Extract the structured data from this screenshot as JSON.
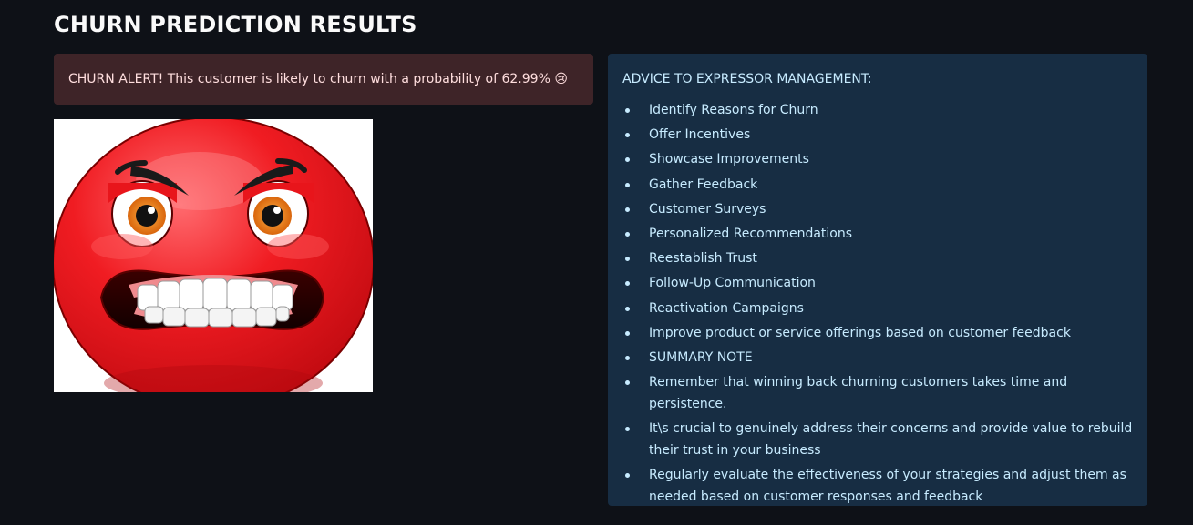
{
  "header": {
    "title": "CHURN PREDICTION RESULTS"
  },
  "alert": {
    "text": "CHURN ALERT! This customer is likely to churn with a probability of 62.99% 😢"
  },
  "advice": {
    "heading": "ADVICE TO EXPRESSOR MANAGEMENT:",
    "items": [
      "Identify Reasons for Churn",
      "Offer Incentives",
      "Showcase Improvements",
      "Gather Feedback",
      "Customer Surveys",
      "Personalized Recommendations",
      "Reestablish Trust",
      "Follow-Up Communication",
      "Reactivation Campaigns",
      "Improve product or service offerings based on customer feedback",
      "SUMMARY NOTE",
      "Remember that winning back churning customers takes time and persistence.",
      "It\\s crucial to genuinely address their concerns and provide value to rebuild their trust in your business",
      "Regularly evaluate the effectiveness of your strategies and adjust them as needed based on customer responses and feedback"
    ]
  },
  "colors": {
    "background": "#0e1117",
    "alert_bg": "#3e2428",
    "alert_text": "#ffdede",
    "info_bg": "#172d43",
    "info_text": "#c7ebff",
    "emoji_red": "#e8151b"
  },
  "image": {
    "icon": "angry-face-emoji"
  }
}
